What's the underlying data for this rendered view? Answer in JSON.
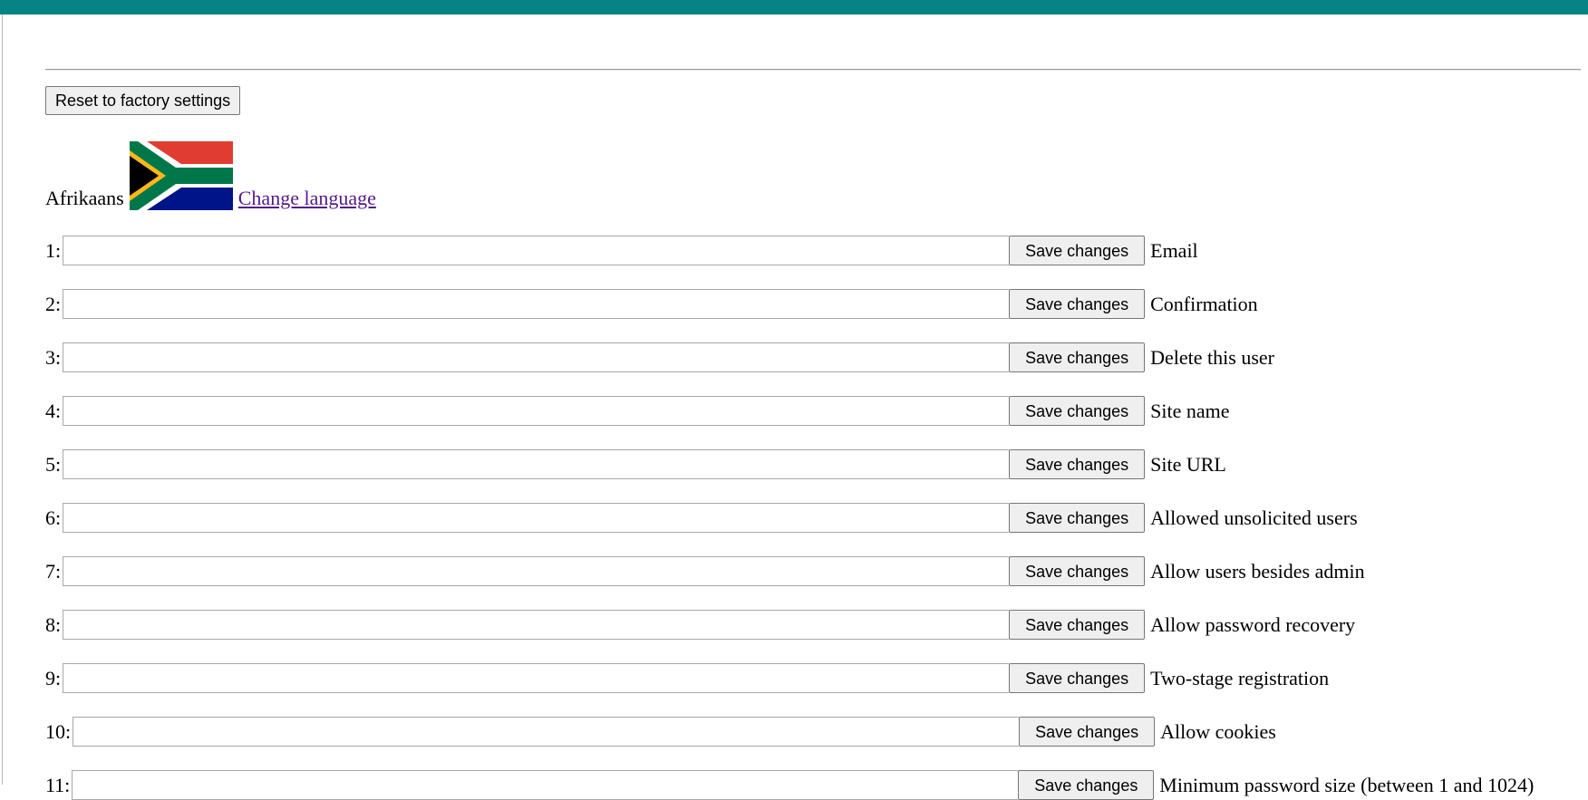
{
  "reset_button": "Reset to factory settings",
  "language": {
    "name": "Afrikaans",
    "flag_icon": "south-africa-flag-icon",
    "change_link": "Change language"
  },
  "colors": {
    "top_bar": "#058483",
    "link": "#551a8b"
  },
  "rows": [
    {
      "number": "1:",
      "value": "",
      "button": "Save changes",
      "label": "Email"
    },
    {
      "number": "2:",
      "value": "",
      "button": "Save changes",
      "label": "Confirmation"
    },
    {
      "number": "3:",
      "value": "",
      "button": "Save changes",
      "label": "Delete this user"
    },
    {
      "number": "4:",
      "value": "",
      "button": "Save changes",
      "label": "Site name"
    },
    {
      "number": "5:",
      "value": "",
      "button": "Save changes",
      "label": "Site URL"
    },
    {
      "number": "6:",
      "value": "",
      "button": "Save changes",
      "label": "Allowed unsolicited users"
    },
    {
      "number": "7:",
      "value": "",
      "button": "Save changes",
      "label": "Allow users besides admin"
    },
    {
      "number": "8:",
      "value": "",
      "button": "Save changes",
      "label": "Allow password recovery"
    },
    {
      "number": "9:",
      "value": "",
      "button": "Save changes",
      "label": "Two-stage registration"
    },
    {
      "number": "10:",
      "value": "",
      "button": "Save changes",
      "label": "Allow cookies"
    },
    {
      "number": "11:",
      "value": "",
      "button": "Save changes",
      "label": "Minimum password size (between 1 and 1024)"
    }
  ]
}
